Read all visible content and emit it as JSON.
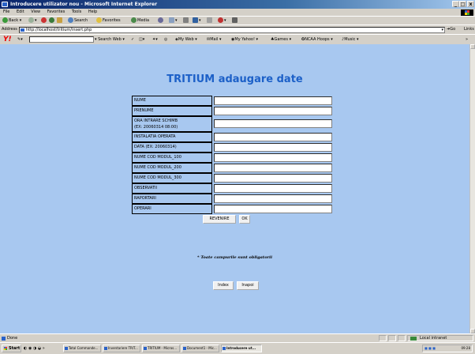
{
  "window": {
    "title": "Introducere utilizator nou - Microsoft Internet Explorer",
    "buttons": [
      "_",
      "□",
      "x"
    ]
  },
  "menu": [
    "File",
    "Edit",
    "View",
    "Favorites",
    "Tools",
    "Help"
  ],
  "toolbar": {
    "back": "Back",
    "search": "Search",
    "favorites": "Favorites",
    "media": "Media"
  },
  "address": {
    "label": "Address",
    "url": "http://localhost/tritium/insert.php",
    "go": "Go",
    "links": "Links"
  },
  "yahoo_toolbar": {
    "logo": "Y!",
    "search_web": "Search Web",
    "my_web": "My Web",
    "mail": "Mail",
    "my_yahoo": "My Yahoo!",
    "games": "Games",
    "ncaa": "NCAA Hoops",
    "music": "Music"
  },
  "page": {
    "heading": "TRITIUM adaugare date",
    "fields": [
      {
        "label": "NUME"
      },
      {
        "label": "PRENUME"
      },
      {
        "label": "ORA INTRARE SCHIMB",
        "label2": "(EX: 20060314 08:00)"
      },
      {
        "label": "INSTALATIA OPERATA"
      },
      {
        "label": "DATA (EX: 20060314)"
      },
      {
        "label": "NUME COD MODUL_100"
      },
      {
        "label": "NUME COD MODUL_200"
      },
      {
        "label": "NUME COD MODUL_300"
      },
      {
        "label": "OBSERVATII"
      },
      {
        "label": "RAPORTARI"
      },
      {
        "label": "OPERARI"
      }
    ],
    "reset_button": "REVENIRE",
    "ok_button": "OK",
    "note": "* Toate campurile sunt obligatorii",
    "index_button": "Index",
    "back_button": "Inapoi"
  },
  "status": {
    "text": "Done",
    "zone": "Local intranet"
  },
  "taskbar": {
    "start": "Start",
    "tasks": [
      "Total Commande...",
      "Inventariere TRIT...",
      "TRITIUM - Micros...",
      "Document1 - Mic...",
      "Introducere ut..."
    ],
    "clock": "09:28"
  }
}
